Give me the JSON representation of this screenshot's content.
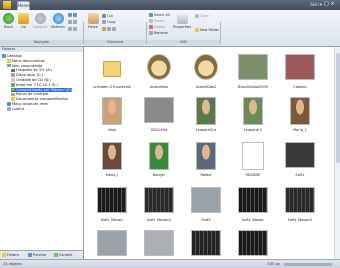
{
  "window": {
    "skin_label": "Skin ▾",
    "minimize": "–",
    "maximize": "□",
    "close": "×"
  },
  "ribbon": {
    "tab_home": "Home",
    "nav": {
      "back": "Back",
      "up": "Up",
      "forward": "Forward",
      "refresh": "Refresh"
    },
    "clipboard": {
      "cut": "Cut",
      "copy": "Copy",
      "paste": "Paste"
    },
    "edit": {
      "select_all": "Select All",
      "invert": "Invert",
      "delete": "Delete",
      "rename": "Rename",
      "properties": "Properties",
      "new_folder": "New Folder",
      "open": "Open"
    },
    "groups": {
      "navigate": "Navigate",
      "clipboard": "Clipboard",
      "edit": "Edit"
    }
  },
  "folders_pane": {
    "title": "Folders",
    "tree": [
      {
        "label": "Desktop",
        "icon": "desktop-icon",
        "selected": false
      },
      {
        "label": "Meus documentos",
        "icon": "folder-icon",
        "selected": false
      },
      {
        "label": "Meu computador",
        "icon": "computer-icon",
        "selected": false
      },
      {
        "label": "Disquete de 3½ (A:)",
        "icon": "floppy-icon",
        "selected": false
      },
      {
        "label": "Disco local (C:)",
        "icon": "drive-icon",
        "selected": false
      },
      {
        "label": "Unidade de CD (D:)",
        "icon": "cd-icon",
        "selected": false
      },
      {
        "label": "temp em 'F1C.10.1 (E:)'",
        "icon": "network-drive-icon",
        "selected": false
      },
      {
        "label": "Compartilhado em 'Marvin' (Z:)",
        "icon": "network-drive-icon",
        "selected": true
      },
      {
        "label": "Painel de controle",
        "icon": "control-panel-icon",
        "selected": false
      },
      {
        "label": "Documentos compartilhados",
        "icon": "folder-icon",
        "selected": false
      },
      {
        "label": "Meus locais de rede",
        "icon": "network-icon",
        "selected": false
      },
      {
        "label": "Lixeira",
        "icon": "trash-icon",
        "selected": false
      }
    ],
    "tabs": [
      {
        "label": "Folders",
        "icon": "folder-icon"
      },
      {
        "label": "Preview",
        "icon": "preview-icon"
      },
      {
        "label": "Content",
        "icon": "content-icon"
      }
    ]
  },
  "files": [
    {
      "name": "unibdam.0.9.portable",
      "kind": "folder",
      "color": "#f2d27a"
    },
    {
      "name": "AvatarDeo",
      "kind": "monkey",
      "color": "#e8c48a"
    },
    {
      "name": "AvatarDeo2",
      "kind": "monkey",
      "color": "#e8c48a"
    },
    {
      "name": "BrasilGlobal2009",
      "kind": "photo",
      "color": "#7a8f6a"
    },
    {
      "name": "Catalan",
      "kind": "photo",
      "color": "#9a5a5a"
    },
    {
      "name": "Dabi",
      "kind": "portrait",
      "color": "#c9a27a"
    },
    {
      "name": "DSC0094",
      "kind": "photo",
      "color": "#8a8a8a"
    },
    {
      "name": "Leopardi3.a",
      "kind": "portrait",
      "color": "#5a7a4a"
    },
    {
      "name": "Leopardi 5",
      "kind": "portrait",
      "color": "#6a8a5a"
    },
    {
      "name": "Mario_2",
      "kind": "portrait",
      "color": "#7a5a3a"
    },
    {
      "name": "Mario_l",
      "kind": "portrait",
      "color": "#6a4a3a"
    },
    {
      "name": "Ranger",
      "kind": "portrait",
      "color": "#3a8a3a"
    },
    {
      "name": "Rafael",
      "kind": "portrait",
      "color": "#5a6a7a"
    },
    {
      "name": "README",
      "kind": "document",
      "color": "#ffffff"
    },
    {
      "name": "Soft1",
      "kind": "photo",
      "color": "#3a3a3a"
    },
    {
      "name": "Soft1 Mosaic",
      "kind": "dark",
      "color": "#1a1a1a"
    },
    {
      "name": "Soft1 Mosaic2",
      "kind": "dark",
      "color": "#2a2a2a"
    },
    {
      "name": "Soft2",
      "kind": "photo",
      "color": "#9aa2aa"
    },
    {
      "name": "Soft1 Mosaic",
      "kind": "dark",
      "color": "#1a1a1a"
    },
    {
      "name": "Soft1 Mosaic2",
      "kind": "dark",
      "color": "#2a2a2a"
    },
    {
      "name": "",
      "kind": "photo",
      "color": "#9aa2aa"
    },
    {
      "name": "",
      "kind": "photo",
      "color": "#aab0b6"
    },
    {
      "name": "",
      "kind": "dark",
      "color": "#222222"
    },
    {
      "name": "",
      "kind": "dark",
      "color": "#1a1a1a"
    }
  ],
  "status": {
    "objects": "23 objects",
    "size": "100 px"
  },
  "colors": {
    "selection": "#2f6fcf",
    "title_bar": "#4a5869",
    "ribbon": "#e6ecf2"
  }
}
